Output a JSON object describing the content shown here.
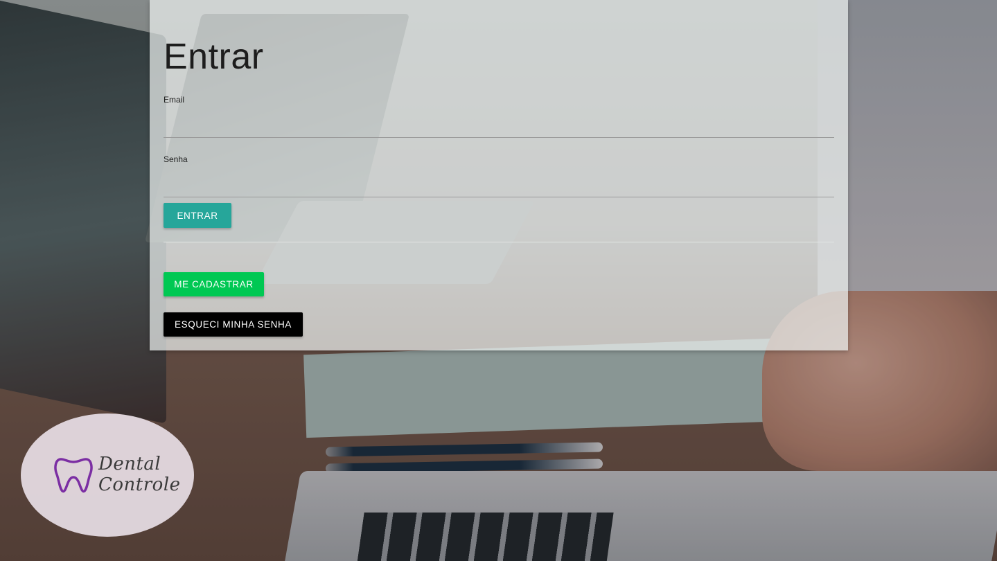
{
  "login": {
    "title": "Entrar",
    "email_label": "Email",
    "email_value": "",
    "password_label": "Senha",
    "password_value": "",
    "submit_label": "ENTRAR"
  },
  "actions": {
    "register_label": "ME CADASTRAR",
    "forgot_label": "ESQUECI MINHA SENHA"
  },
  "logo": {
    "icon": "tooth-icon",
    "line1": "Dental",
    "line2": "Controle"
  },
  "colors": {
    "entrar_button": "#26a69a",
    "register_button": "#00c853",
    "forgot_button": "#000000",
    "tooth_icon": "#7b2ea3"
  }
}
